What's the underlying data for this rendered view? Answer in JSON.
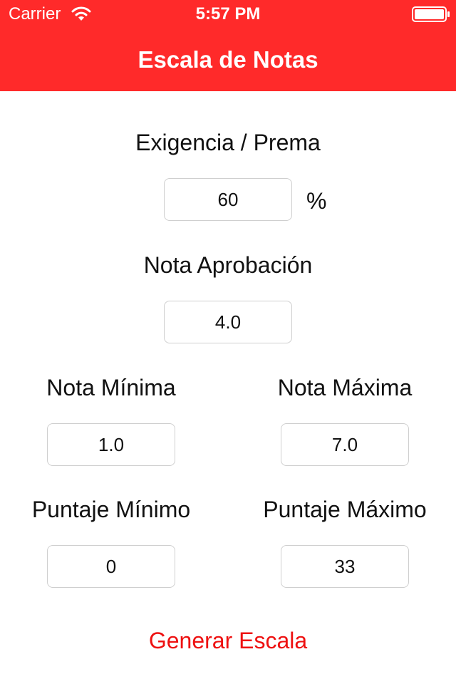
{
  "status_bar": {
    "carrier": "Carrier",
    "time": "5:57 PM",
    "wifi_icon": "wifi-icon",
    "battery_icon": "battery-icon"
  },
  "nav": {
    "title": "Escala de Notas",
    "bar_color": "#ff2a2a"
  },
  "form": {
    "exigencia": {
      "label": "Exigencia / Prema",
      "value": "60",
      "unit": "%"
    },
    "nota_aprobacion": {
      "label": "Nota Aprobación",
      "value": "4.0"
    },
    "nota_minima": {
      "label": "Nota Mínima",
      "value": "1.0"
    },
    "nota_maxima": {
      "label": "Nota Máxima",
      "value": "7.0"
    },
    "puntaje_minimo": {
      "label": "Puntaje Mínimo",
      "value": "0"
    },
    "puntaje_maximo": {
      "label": "Puntaje Máximo",
      "value": "33"
    }
  },
  "actions": {
    "generate_label": "Generar Escala",
    "accent_color": "#ee1111"
  }
}
